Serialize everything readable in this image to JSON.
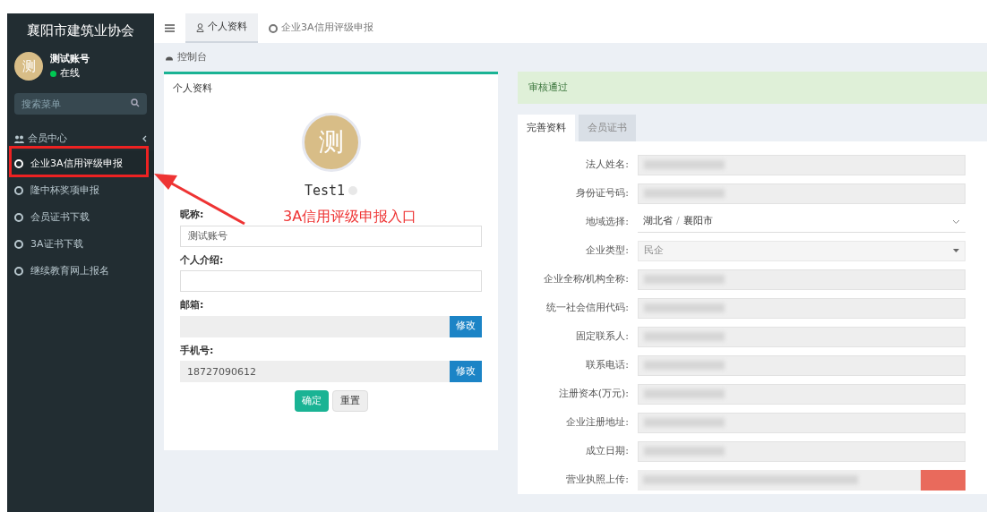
{
  "sidebar": {
    "title": "襄阳市建筑业协会",
    "user": {
      "avatar": "测",
      "name": "测试账号",
      "status": "在线",
      "online": true
    },
    "search": {
      "placeholder": "搜索菜单"
    },
    "group": {
      "label": "会员中心",
      "expanded": true
    },
    "items": [
      {
        "label": "企业3A信用评级申报",
        "selected": true
      },
      {
        "label": "隆中杯奖项申报",
        "selected": false
      },
      {
        "label": "会员证书下载",
        "selected": false
      },
      {
        "label": "3A证书下载",
        "selected": false
      },
      {
        "label": "继续教育网上报名",
        "selected": false
      }
    ]
  },
  "top_tabs": [
    {
      "label": "个人资料",
      "kind": "user",
      "selected": true
    },
    {
      "label": "企业3A信用评级申报",
      "kind": "circle",
      "selected": false
    }
  ],
  "breadcrumb": "控制台",
  "profile": {
    "title": "个人资料",
    "avatar": "测",
    "name": "Test1",
    "fields": [
      {
        "label": "昵称:",
        "value": "测试账号",
        "kind": "text"
      },
      {
        "label": "个人介绍:",
        "kind": "text"
      },
      {
        "label": "邮箱:",
        "kind": "locked",
        "button": "修改"
      },
      {
        "label": "手机号:",
        "value": "18727090612",
        "kind": "locked",
        "button": "修改"
      }
    ],
    "buttons": [
      {
        "label": "确定",
        "kind": "primary"
      },
      {
        "label": "重置",
        "kind": "default"
      }
    ]
  },
  "annotation": {
    "text": "3A信用评级申报入口"
  },
  "review": {
    "alert": "审核通过",
    "tabs": [
      {
        "label": "完善资料",
        "selected": true
      },
      {
        "label": "会员证书",
        "selected": false
      }
    ],
    "fields": [
      {
        "label": "法人姓名:",
        "kind": "blurred"
      },
      {
        "label": "身份证号码:",
        "kind": "blurred"
      },
      {
        "label": "地域选择:",
        "kind": "cascader",
        "value": "湖北省",
        "value2": "襄阳市",
        "separator": "/"
      },
      {
        "label": "企业类型:",
        "kind": "select",
        "value": "民企"
      },
      {
        "label": "企业全称/机构全称:",
        "kind": "blurred"
      },
      {
        "label": "统一社会信用代码:",
        "kind": "blurred"
      },
      {
        "label": "固定联系人:",
        "kind": "blurred"
      },
      {
        "label": "联系电话:",
        "kind": "blurred"
      },
      {
        "label": "注册资本(万元):",
        "kind": "blurred"
      },
      {
        "label": "企业注册地址:",
        "kind": "blurred"
      },
      {
        "label": "成立日期:",
        "kind": "blurred"
      },
      {
        "label": "营业执照上传:",
        "kind": "upload"
      }
    ]
  }
}
